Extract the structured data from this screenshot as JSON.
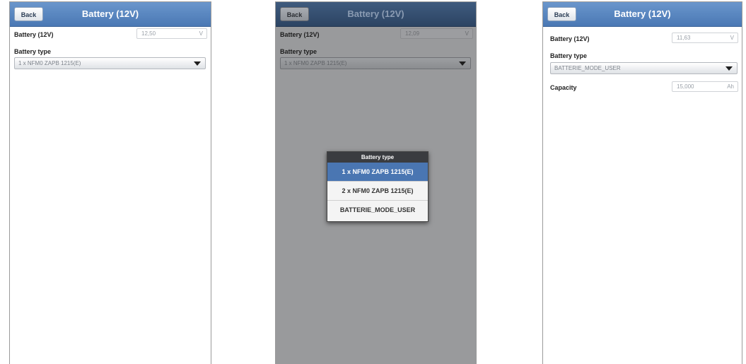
{
  "screens": [
    {
      "back_label": "Back",
      "title": "Battery (12V)",
      "voltage_label": "Battery (12V)",
      "voltage_value": "12,50",
      "voltage_unit": "V",
      "type_label": "Battery type",
      "type_value": "1 x NFM0 ZAPB 1215(E)"
    },
    {
      "back_label": "Back",
      "title": "Battery (12V)",
      "voltage_label": "Battery (12V)",
      "voltage_value": "12,09",
      "voltage_unit": "V",
      "type_label": "Battery type",
      "type_value": "1 x NFM0 ZAPB 1215(E)",
      "dialog": {
        "title": "Battery type",
        "options": [
          "1 x NFM0 ZAPB 1215(E)",
          "2 x NFM0 ZAPB 1215(E)",
          "BATTERIE_MODE_USER"
        ],
        "selected_index": 0
      }
    },
    {
      "back_label": "Back",
      "title": "Battery (12V)",
      "voltage_label": "Battery (12V)",
      "voltage_value": "11,63",
      "voltage_unit": "V",
      "type_label": "Battery type",
      "type_value": "BATTERIE_MODE_USER",
      "capacity_label": "Capacity",
      "capacity_value": "15,000",
      "capacity_unit": "Ah"
    }
  ]
}
